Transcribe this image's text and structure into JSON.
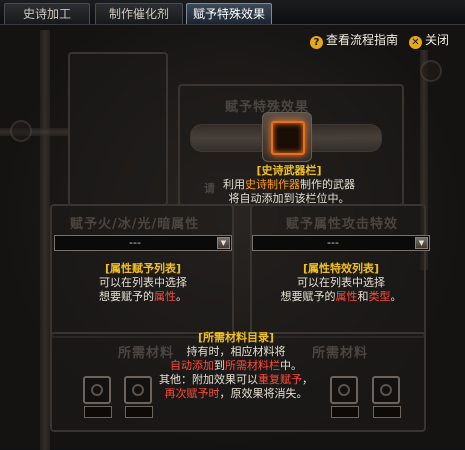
{
  "tabs": [
    "史诗加工",
    "制作催化剂",
    "赋予特殊效果"
  ],
  "active_tab": 2,
  "links": {
    "guide": "查看流程指南",
    "close": "关闭",
    "guide_icon": "question-icon",
    "close_icon": "close-x-icon"
  },
  "ghost_titles": {
    "main": "赋予特殊效果",
    "left": "赋予火/冰/光/暗属性",
    "right": "赋予属性攻击特效",
    "mat_left": "所需材料",
    "mat_right": "所需材料"
  },
  "weapon_slot": {
    "title": "[史诗武器栏]",
    "line1_a": "利用",
    "line1_b": "史诗制作器",
    "line1_c": "制作的武器",
    "line2": "将自动添加到该栏位中。",
    "ghost_line": "请"
  },
  "dropdowns": {
    "left_value": "---",
    "right_value": "---"
  },
  "attr_list": {
    "title": "[属性赋予列表]",
    "line1": "可以在列表中选择",
    "line2_a": "想要赋予的",
    "line2_b": "属性",
    "line2_c": "。"
  },
  "effect_list": {
    "title": "[属性特效列表]",
    "line1": "可以在列表中选择",
    "line2_a": "想要赋予的",
    "line2_b": "属性",
    "line2_c": "和",
    "line2_d": "类型",
    "line2_e": "。"
  },
  "materials": {
    "title": "[所需材料目录]",
    "line1": "持有时，相应材料将",
    "line2_a": "自动添加",
    "line2_b": "到",
    "line2_c": "所需材料栏",
    "line2_d": "中。",
    "line3_a": "其他：附加效果可以",
    "line3_b": "重复赋予",
    "line3_c": "，",
    "line4_a": "再次赋予时",
    "line4_b": "，原效果将消失。"
  },
  "colors": {
    "highlight_gold": "#f0c020",
    "highlight_orange": "#ff9a1c",
    "highlight_red": "#ff4a3a",
    "slot_glow": "#ff7a1c"
  }
}
